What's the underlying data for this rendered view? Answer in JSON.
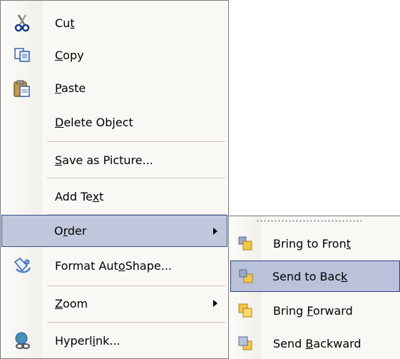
{
  "main_menu": {
    "items": [
      {
        "pre": "Cu",
        "acc": "t",
        "post": "",
        "icon": "scissors-icon"
      },
      {
        "pre": "",
        "acc": "C",
        "post": "opy",
        "icon": "copy-icon"
      },
      {
        "pre": "",
        "acc": "P",
        "post": "aste",
        "icon": "paste-icon"
      },
      {
        "pre": "",
        "acc": "D",
        "post": "elete Object",
        "icon": ""
      },
      {
        "pre": "",
        "acc": "S",
        "post": "ave as Picture...",
        "icon": ""
      },
      {
        "pre": "Add Te",
        "acc": "x",
        "post": "t",
        "icon": ""
      },
      {
        "pre": "O",
        "acc": "r",
        "post": "der",
        "icon": "",
        "submenu": true,
        "highlighted": true
      },
      {
        "pre": "Format Aut",
        "acc": "o",
        "post": "Shape...",
        "icon": "format-autoshape-icon"
      },
      {
        "pre": "",
        "acc": "Z",
        "post": "oom",
        "icon": "",
        "submenu": true
      },
      {
        "pre": "Hyperl",
        "acc": "i",
        "post": "nk...",
        "icon": "hyperlink-icon"
      }
    ]
  },
  "submenu": {
    "items": [
      {
        "pre": "Bring to Fron",
        "acc": "t",
        "post": "",
        "icon": "bring-to-front-icon"
      },
      {
        "pre": "Send to Bac",
        "acc": "k",
        "post": "",
        "icon": "send-to-back-icon",
        "selected": true
      },
      {
        "pre": "Bring ",
        "acc": "F",
        "post": "orward",
        "icon": "bring-forward-icon"
      },
      {
        "pre": "Send ",
        "acc": "B",
        "post": "ackward",
        "icon": "send-backward-icon"
      }
    ]
  },
  "colors": {
    "highlight": "#c1c8dd",
    "highlight_border": "#3d4f83",
    "menu_bg": "#f9f8f5"
  }
}
